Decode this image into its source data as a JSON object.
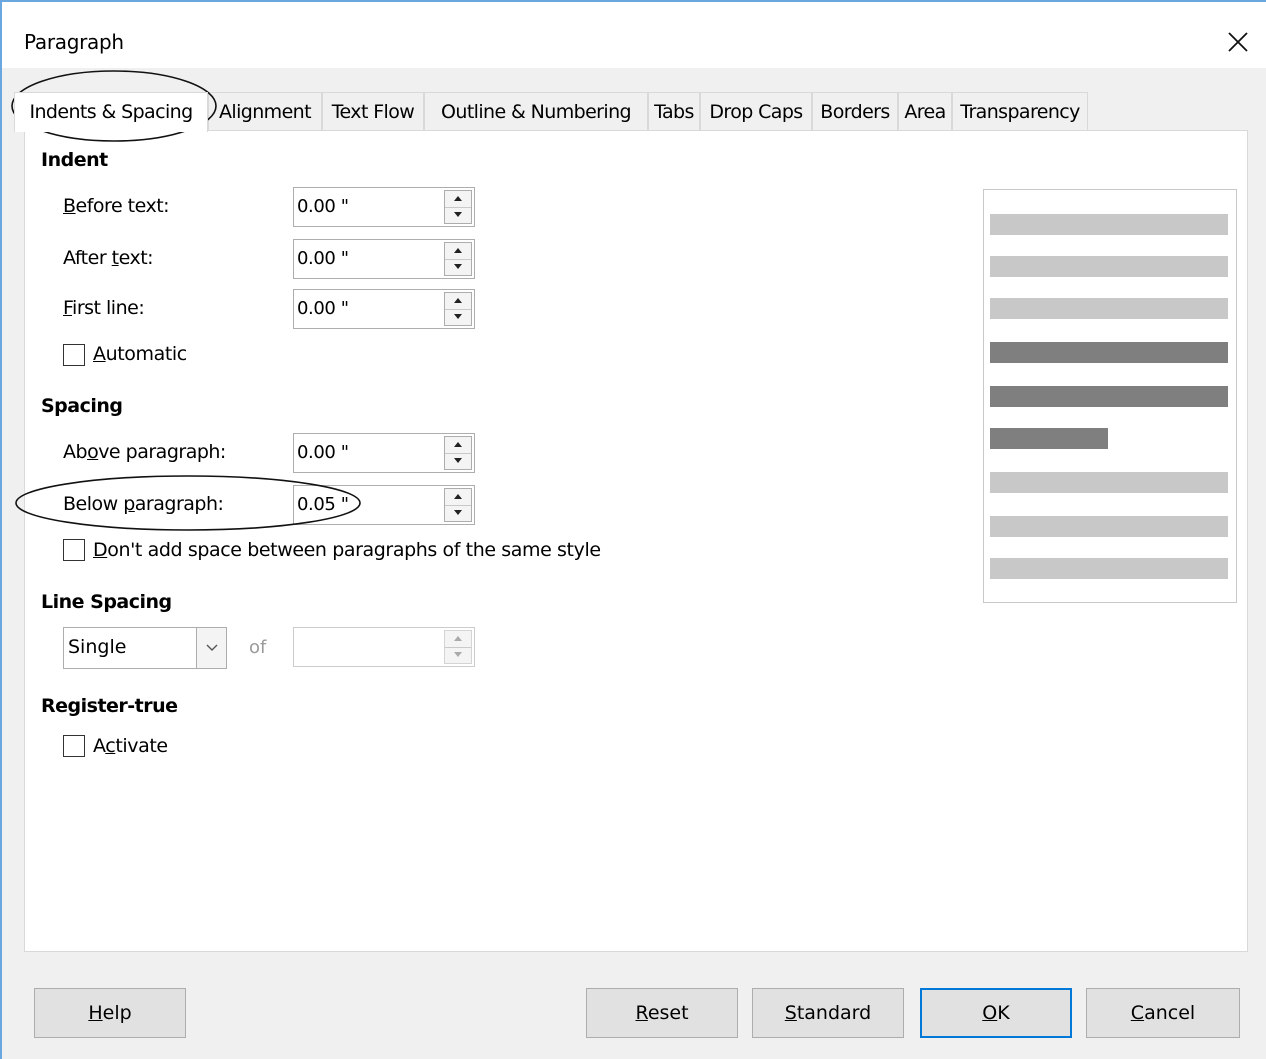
{
  "window": {
    "title": "Paragraph",
    "close_icon": "close-icon"
  },
  "tabs": [
    {
      "label": "Indents & Spacing",
      "active": true
    },
    {
      "label": "Alignment"
    },
    {
      "label": "Text Flow"
    },
    {
      "label": "Outline & Numbering"
    },
    {
      "label": "Tabs"
    },
    {
      "label": "Drop Caps"
    },
    {
      "label": "Borders"
    },
    {
      "label": "Area"
    },
    {
      "label": "Transparency"
    }
  ],
  "indent": {
    "title": "Indent",
    "before_text": {
      "label_u": "B",
      "label_rest": "efore text:",
      "value": "0.00 \""
    },
    "after_text": {
      "label_pre": "After ",
      "label_u": "t",
      "label_rest": "ext:",
      "value": "0.00 \""
    },
    "first_line": {
      "label_u": "F",
      "label_rest": "irst line:",
      "value": "0.00 \""
    },
    "automatic": {
      "label_u": "A",
      "label_rest": "utomatic",
      "checked": false
    }
  },
  "spacing": {
    "title": "Spacing",
    "above": {
      "label_pre": "Ab",
      "label_u": "o",
      "label_rest": "ve paragraph:",
      "value": "0.00 \""
    },
    "below": {
      "label_pre": "Below ",
      "label_u": "p",
      "label_rest": "aragraph:",
      "value": "0.05 \""
    },
    "no_space": {
      "label_u": "D",
      "label_rest": "on't add space between paragraphs of the same style",
      "checked": false
    }
  },
  "line_spacing": {
    "title": "Line Spacing",
    "selected": "Single",
    "of_label": "of",
    "of_value": ""
  },
  "register_true": {
    "title": "Register-true",
    "activate": {
      "label_pre": "A",
      "label_u": "c",
      "label_rest": "tivate",
      "checked": false
    }
  },
  "preview": {
    "colors": {
      "light": "#c8c8c8",
      "dark": "#7f7f7f"
    },
    "lines": [
      "light",
      "light",
      "light",
      "dark",
      "dark",
      "dark-short",
      "light",
      "light",
      "light"
    ]
  },
  "buttons": {
    "help": {
      "label_u": "H",
      "label_rest": "elp"
    },
    "reset": {
      "label_u": "R",
      "label_rest": "eset"
    },
    "standard": {
      "label_u": "S",
      "label_rest": "tandard"
    },
    "ok": {
      "label_u": "O",
      "label_rest": "K"
    },
    "cancel": {
      "label_u": "C",
      "label_rest": "ancel"
    }
  },
  "colors": {
    "accent": "#0078d7",
    "window_border": "#6aa7de"
  }
}
